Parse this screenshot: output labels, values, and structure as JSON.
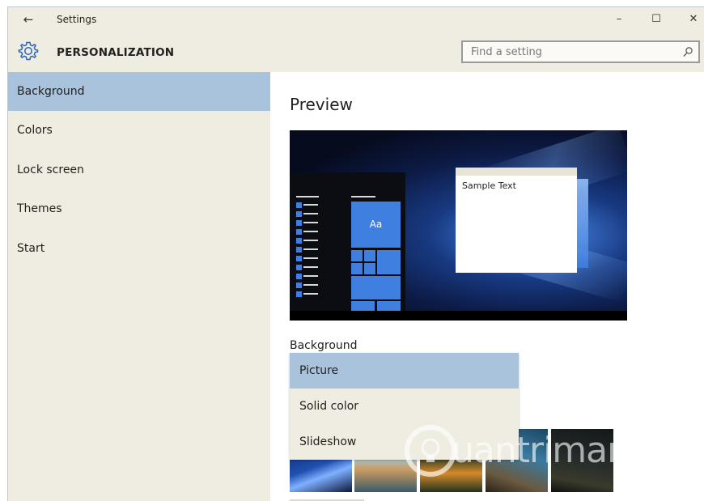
{
  "window": {
    "title": "Settings",
    "minimize_glyph": "–",
    "maximize_glyph": "☐",
    "close_glyph": "✕",
    "back_glyph": "←"
  },
  "header": {
    "title": "PERSONALIZATION",
    "icon": "gear-icon",
    "search_placeholder": "Find a setting",
    "search_icon": "search-icon"
  },
  "sidebar": {
    "items": [
      {
        "label": "Background",
        "selected": true
      },
      {
        "label": "Colors",
        "selected": false
      },
      {
        "label": "Lock screen",
        "selected": false
      },
      {
        "label": "Themes",
        "selected": false
      },
      {
        "label": "Start",
        "selected": false
      }
    ]
  },
  "main": {
    "preview_heading": "Preview",
    "preview": {
      "tile_label": "Aa",
      "sample_text": "Sample Text"
    },
    "background_label": "Background",
    "dropdown": {
      "options": [
        {
          "label": "Picture",
          "selected": true
        },
        {
          "label": "Solid color",
          "selected": false
        },
        {
          "label": "Slideshow",
          "selected": false
        }
      ]
    }
  },
  "watermark": {
    "text": "uantrimang"
  },
  "colors": {
    "accent": "#3f7fe0",
    "selection": "#a9c3dc",
    "sidebar_bg": "#efece1"
  }
}
